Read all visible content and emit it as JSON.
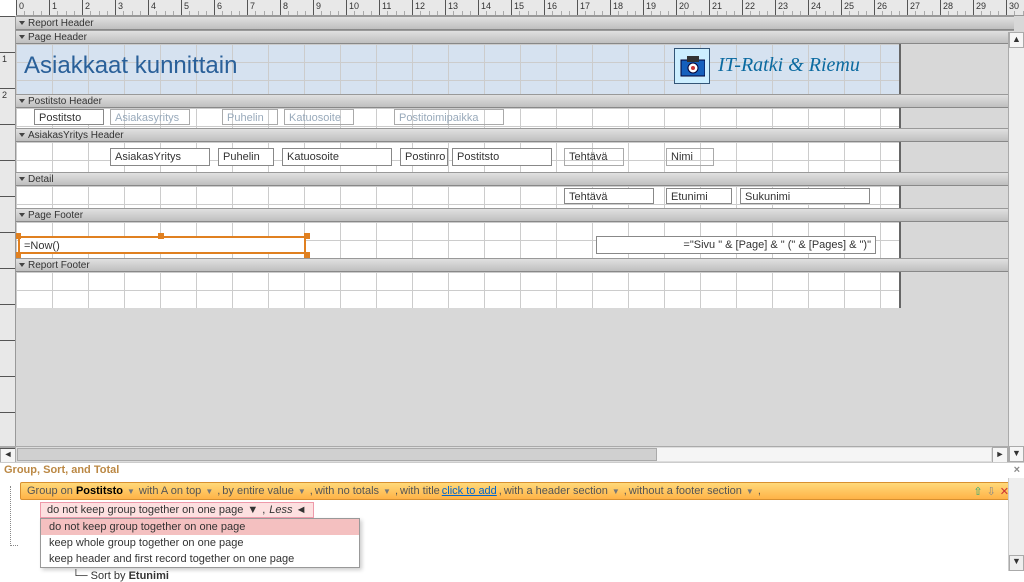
{
  "sections": {
    "report_header": "Report Header",
    "page_header": "Page Header",
    "postitsto_header": "Postitsto Header",
    "asiakasyritys_header": "AsiakasYritys Header",
    "detail": "Detail",
    "page_footer": "Page Footer",
    "report_footer": "Report Footer"
  },
  "page_header_ctls": {
    "title": "Asiakkaat kunnittain",
    "logo_text": "IT-Ratki & Riemu"
  },
  "postitsto_hdr": {
    "postitsto": "Postitsto",
    "asiakasyritys": "Asiakasyritys",
    "puhelin": "Puhelin",
    "katuosoite": "Katuosoite",
    "postitoimipaikka": "Postitoimipaikka"
  },
  "asiakas_hdr": {
    "asiakasyritys": "AsiakasYritys",
    "puhelin": "Puhelin",
    "katuosoite": "Katuosoite",
    "postinro": "Postinro",
    "postitsto": "Postitsto",
    "tehtava": "Tehtävä",
    "nimi": "Nimi"
  },
  "detail_ctls": {
    "tehtava": "Tehtävä",
    "etunimi": "Etunimi",
    "sukunimi": "Sukunimi"
  },
  "page_footer_ctls": {
    "now": "=Now()",
    "page_expr": "=\"Sivu \" & [Page] & \" (\" & [Pages] & \")\""
  },
  "gst": {
    "title": "Group, Sort, and Total",
    "group_on": "Group on",
    "field": "Postitsto",
    "with_a_on_top": "with A on top",
    "by_entire_value": "by entire value",
    "with_no_totals": "with no totals",
    "with_title": "with title",
    "click_to_add": "click to add",
    "with_header": "with a header section",
    "without_footer": "without a footer section",
    "keep_option_current": "do not keep group together on one page",
    "less": "Less",
    "options": {
      "o1": "do not keep group together on one page",
      "o2": "keep whole group together on one page",
      "o3": "keep header and first record together on one page"
    },
    "sort_by": "Sort by",
    "sort_field": "Etunimi"
  }
}
